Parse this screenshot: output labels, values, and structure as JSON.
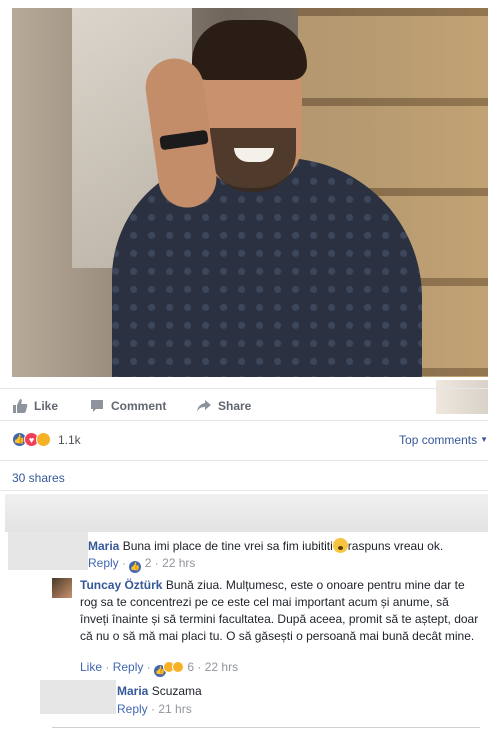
{
  "actions": {
    "like": "Like",
    "comment": "Comment",
    "share": "Share"
  },
  "reactions": {
    "icons": [
      "like-icon",
      "love-icon",
      "wow-icon"
    ],
    "count": "1.1k"
  },
  "top_comments": "Top comments",
  "shares": "30 shares",
  "comments": [
    {
      "name": "Maria",
      "text": "Buna imi place de tine vrei sa fim iubititi",
      "text_after": "raspuns vreau ok.",
      "reply": "Reply",
      "likes": "2",
      "time": "22 hrs"
    },
    {
      "name": "Tuncay Öztürk",
      "text": "Bună ziua. Mulțumesc, este o onoare pentru mine dar te rog sa te concentrezi pe ce este cel mai important acum și anume, să înveți înainte și să termini facultatea. După aceea, promit să te aștept, doar că nu o să mă mai placi tu. O să găsești o persoană mai bună decât mine.",
      "like": "Like",
      "reply": "Reply",
      "likes": "6",
      "time": "22 hrs"
    },
    {
      "name": "Maria",
      "text": "Scuzama",
      "reply": "Reply",
      "time": "21 hrs"
    }
  ],
  "colors": {
    "link": "#365899",
    "accent": "#4267b2",
    "muted": "#90949c"
  }
}
